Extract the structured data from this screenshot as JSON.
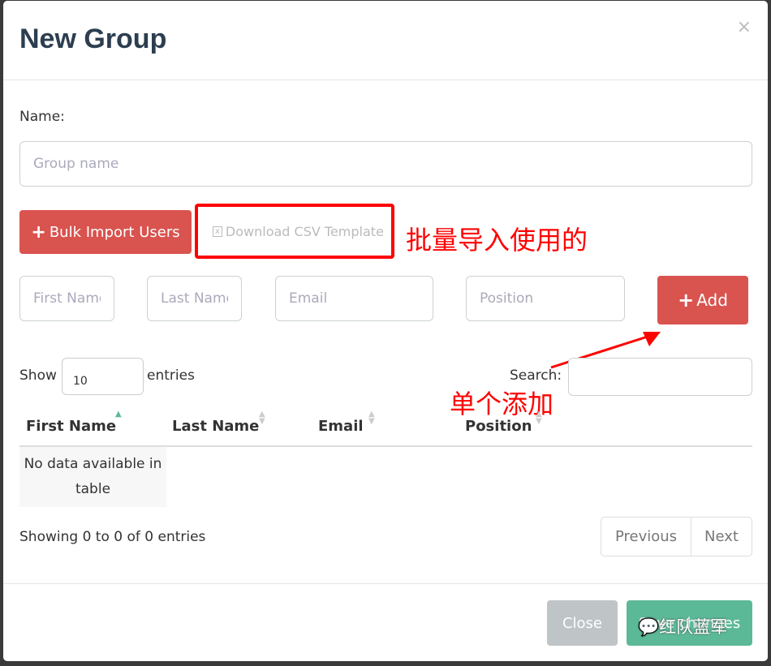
{
  "modal": {
    "title": "New Group",
    "close_icon": "×"
  },
  "form": {
    "name_label": "Name:",
    "name_placeholder": "Group name",
    "bulk_import": "Bulk Import Users",
    "download_csv": "Download CSV Template",
    "first_name_placeholder": "First Name",
    "last_name_placeholder": "Last Name",
    "email_placeholder": "Email",
    "position_placeholder": "Position",
    "add": "Add"
  },
  "table": {
    "show": "Show",
    "entries_value": "10",
    "entries": "entries",
    "search": "Search:",
    "columns": [
      "First Name",
      "Last Name",
      "Email",
      "Position"
    ],
    "empty": "No data available in table",
    "info": "Showing 0 to 0 of 0 entries",
    "previous": "Previous",
    "next": "Next"
  },
  "footer": {
    "close": "Close",
    "save": "Save changes"
  },
  "annotations": {
    "bulk_note": "批量导入使用的",
    "single_note": "单个添加",
    "color": "#ff0000"
  },
  "watermark": "红队蓝军",
  "colors": {
    "danger": "#d9534f",
    "success": "#5cb998",
    "secondary": "#bfc4c6"
  }
}
